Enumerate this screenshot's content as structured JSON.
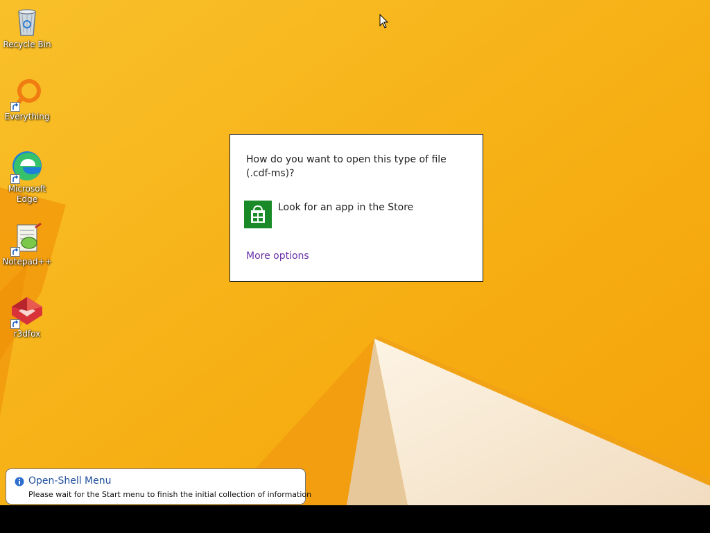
{
  "desktop": {
    "icons": [
      {
        "label": "Recycle Bin"
      },
      {
        "label": "Everything"
      },
      {
        "label": "Microsoft Edge"
      },
      {
        "label": "Notepad++"
      },
      {
        "label": "r3dfox"
      }
    ]
  },
  "dialog": {
    "question": "How do you want to open this type of file (.cdf-ms)?",
    "store_option_label": "Look for an app in the Store",
    "more_options_label": "More options"
  },
  "notification": {
    "title": "Open-Shell Menu",
    "message": "Please wait for the Start menu to finish the initial collection of information"
  },
  "colors": {
    "wallpaper": "#f7b51a",
    "store_tile": "#1a8a28",
    "link": "#6a31a8",
    "notification_title": "#1f4f9c",
    "taskbar": "#000000"
  }
}
